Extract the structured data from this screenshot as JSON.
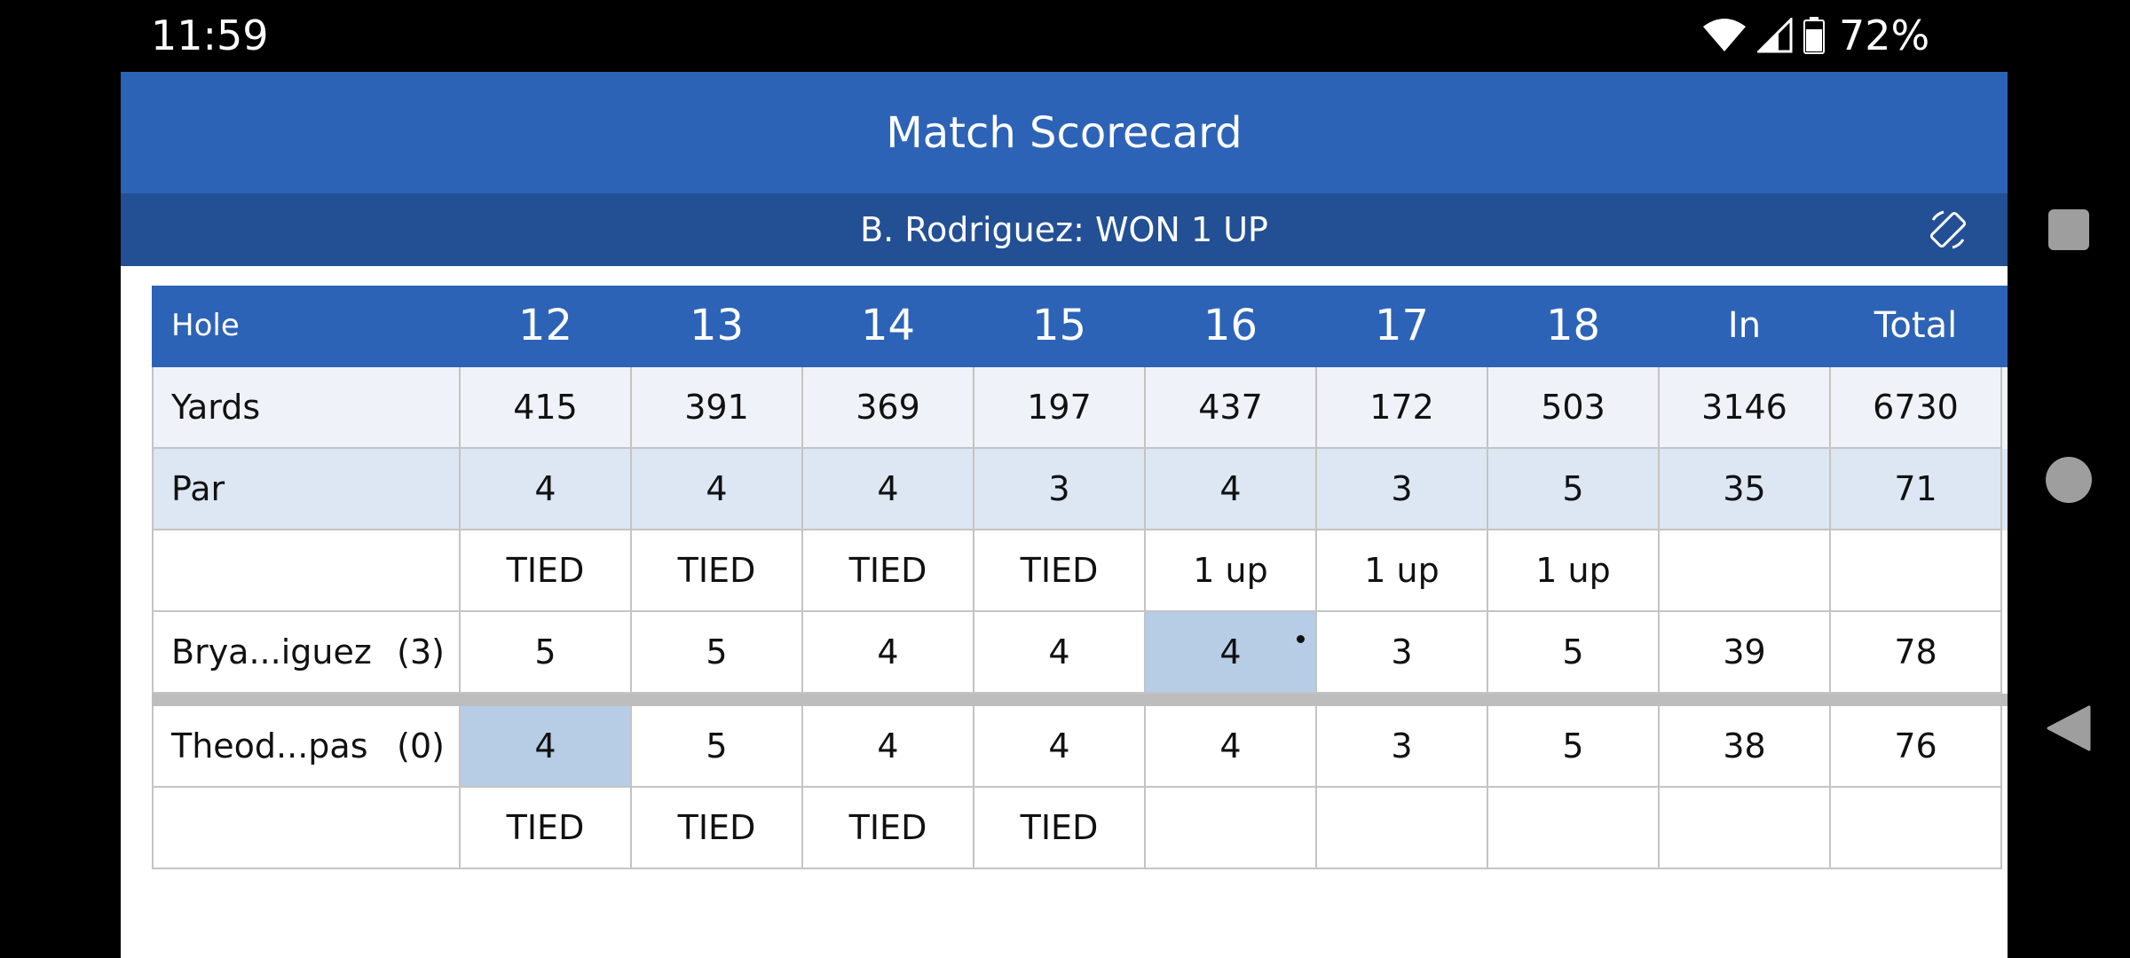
{
  "status_bar": {
    "time": "11:59",
    "battery": "72%",
    "icons": [
      "wifi-icon",
      "cellular-signal-icon",
      "battery-icon"
    ]
  },
  "app": {
    "title": "Match Scorecard",
    "result": "B. Rodriguez: WON 1 UP",
    "rotate_icon": "screen-rotation-icon"
  },
  "scorecard": {
    "header": {
      "label": "Hole",
      "holes": [
        "12",
        "13",
        "14",
        "15",
        "16",
        "17",
        "18"
      ],
      "in": "In",
      "total": "Total"
    },
    "yards": {
      "label": "Yards",
      "values": [
        "415",
        "391",
        "369",
        "197",
        "437",
        "172",
        "503"
      ],
      "in": "3146",
      "total": "6730"
    },
    "par": {
      "label": "Par",
      "values": [
        "4",
        "4",
        "4",
        "3",
        "4",
        "3",
        "5"
      ],
      "in": "35",
      "total": "71"
    },
    "status_top": [
      "TIED",
      "TIED",
      "TIED",
      "TIED",
      "1 up",
      "1 up",
      "1 up"
    ],
    "player1": {
      "name": "Brya...iguez",
      "handicap": "(3)",
      "scores": [
        "5",
        "5",
        "4",
        "4",
        "4",
        "3",
        "5"
      ],
      "in": "39",
      "total": "78",
      "highlight_hole": "16"
    },
    "player2": {
      "name": "Theod...pas",
      "handicap": "(0)",
      "scores": [
        "4",
        "5",
        "4",
        "4",
        "4",
        "3",
        "5"
      ],
      "in": "38",
      "total": "76",
      "highlight_hole": "12"
    },
    "status_bottom": [
      "TIED",
      "TIED",
      "TIED",
      "TIED",
      "",
      "",
      ""
    ]
  },
  "colors": {
    "header_blue": "#2d63b7",
    "result_blue": "#234f94",
    "highlight": "#b7cde6",
    "yards_bg": "#eff2f8",
    "par_bg": "#dde6f3"
  },
  "nav_bar": {
    "icons": [
      "recents-icon",
      "home-icon",
      "back-icon"
    ]
  }
}
